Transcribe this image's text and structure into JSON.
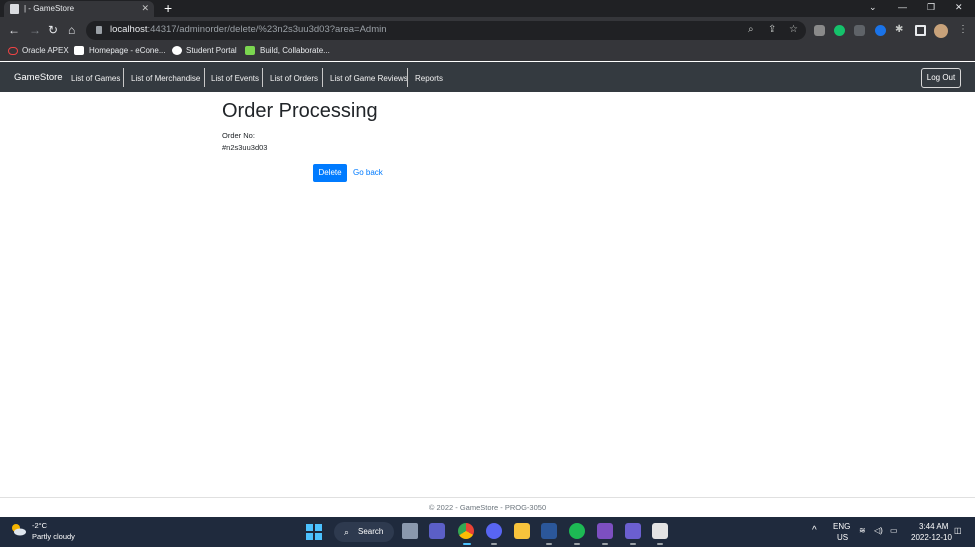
{
  "browser": {
    "tab_title": "| - GameStore",
    "url_host": "localhost",
    "url_rest": ":44317/adminorder/delete/%23n2s3uu3d03?area=Admin",
    "bookmarks": [
      "Oracle APEX",
      "Homepage - eCone...",
      "Student Portal",
      "Build, Collaborate..."
    ]
  },
  "site": {
    "brand": "GameStore",
    "nav": [
      "List of Games",
      "List of Merchandise",
      "List of Events",
      "List of Orders",
      "List of Game Reviews",
      "Reports"
    ],
    "logout": "Log Out"
  },
  "page": {
    "heading": "Order Processing",
    "order_label": "Order No:",
    "order_value": "#n2s3uu3d03",
    "delete_button": "Delete",
    "go_back": "Go back"
  },
  "footer": "© 2022 - GameStore - PROG-3050",
  "taskbar": {
    "temperature": "-2°C",
    "condition": "Partly cloudy",
    "search": "Search",
    "lang": "ENG",
    "region": "US",
    "time": "3:44 AM",
    "date": "2022-12-10"
  },
  "colors": {
    "navbar": "#343a40",
    "primary": "#007bff",
    "taskbar": "#1f2a3d"
  }
}
